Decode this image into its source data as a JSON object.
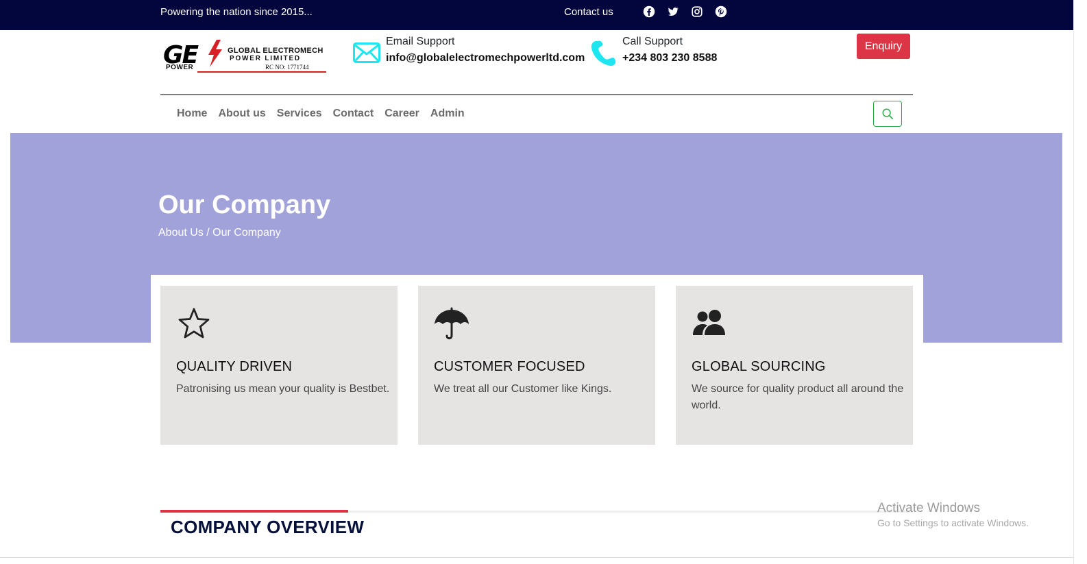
{
  "topbar": {
    "tagline": "Powering the nation since 2015...",
    "contact_label": "Contact us",
    "socials": [
      "facebook-icon",
      "twitter-icon",
      "instagram-icon",
      "pinterest-icon"
    ]
  },
  "header": {
    "logo": {
      "mark": "GE",
      "line1": "GLOBAL ELECTROMECH",
      "line2": "POWER LIMITED",
      "line3": "RC NO: 1771744",
      "power": "POWER"
    },
    "email_support": {
      "label": "Email Support",
      "value": "info@globalelectromechpowerltd.com",
      "icon": "envelope-icon"
    },
    "call_support": {
      "label": "Call Support",
      "value": "+234 803 230 8588",
      "icon": "phone-icon"
    },
    "enquiry_label": "Enquiry"
  },
  "nav": {
    "items": [
      "Home",
      "About us",
      "Services",
      "Contact",
      "Career",
      "Admin"
    ],
    "search_icon": "search-icon"
  },
  "hero": {
    "title": "Our Company",
    "breadcrumb": "About Us / Our Company"
  },
  "features": [
    {
      "icon": "star-icon",
      "title": "QUALITY DRIVEN",
      "desc": "Patronising us mean your quality is Bestbet."
    },
    {
      "icon": "umbrella-icon",
      "title": "CUSTOMER FOCUSED",
      "desc": "We treat all our Customer like Kings."
    },
    {
      "icon": "users-icon",
      "title": "GLOBAL SOURCING",
      "desc": "We source for quality product all around the world."
    }
  ],
  "overview": {
    "title": "COMPANY OVERVIEW"
  },
  "watermark": {
    "title": "Activate Windows",
    "subtitle": "Go to Settings to activate Windows."
  },
  "colors": {
    "topbar": "#03063d",
    "hero": "#a2a2da",
    "accent_red": "#dc3545",
    "icon_cyan": "#1ee6f0",
    "search_green": "#28a745",
    "card_bg": "#e6e3e3"
  }
}
